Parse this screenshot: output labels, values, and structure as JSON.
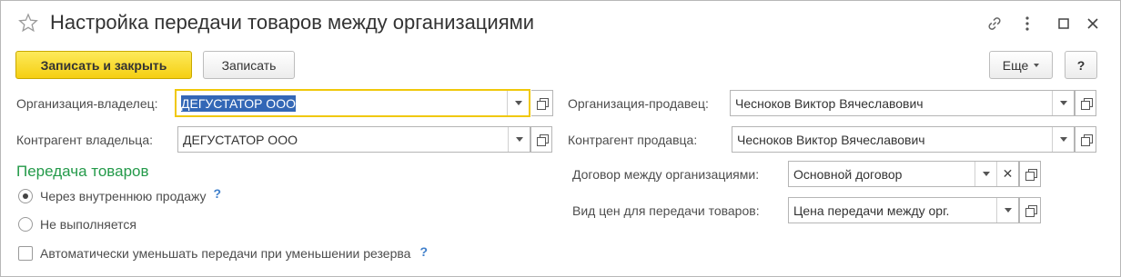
{
  "window": {
    "title": "Настройка передачи товаров между организациями"
  },
  "toolbar": {
    "save_close_label": "Записать и закрыть",
    "save_label": "Записать",
    "more_label": "Еще",
    "help_label": "?"
  },
  "left": {
    "owner_org": {
      "label": "Организация-владелец:",
      "value": "ДЕГУСТАТОР ООО"
    },
    "owner_contractor": {
      "label": "Контрагент владельца:",
      "value": "ДЕГУСТАТОР ООО"
    },
    "section_title": "Передача товаров",
    "radio_options": [
      {
        "label": "Через внутреннюю продажу",
        "selected": true,
        "help": "?"
      },
      {
        "label": "Не выполняется",
        "selected": false
      }
    ],
    "auto_reduce": {
      "label": "Автоматически уменьшать передачи при уменьшении резерва",
      "checked": false,
      "help": "?"
    }
  },
  "right": {
    "seller_org": {
      "label": "Организация-продавец:",
      "value": "Чесноков Виктор Вячеславович"
    },
    "seller_contractor": {
      "label": "Контрагент продавца:",
      "value": "Чесноков Виктор Вячеславович"
    },
    "contract": {
      "label": "Договор между организациями:",
      "value": "Основной договор"
    },
    "price_type": {
      "label": "Вид цен для передачи товаров:",
      "value": "Цена передачи между орг."
    }
  },
  "colors": {
    "primary_button": "#f5cf12",
    "section_title": "#249a4a",
    "focus_border": "#f0c80a",
    "selection": "#3367b6",
    "help": "#3f7fcb"
  }
}
